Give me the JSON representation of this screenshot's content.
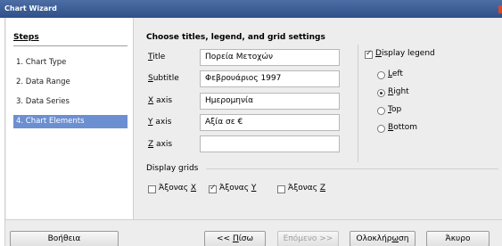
{
  "window": {
    "title": "Chart Wizard"
  },
  "steps": {
    "title": "Steps",
    "items": [
      {
        "label": "1. Chart Type"
      },
      {
        "label": "2. Data Range"
      },
      {
        "label": "3. Data Series"
      },
      {
        "label": "4. Chart Elements",
        "active": true
      }
    ]
  },
  "content": {
    "section_title": "Choose titles, legend, and grid settings",
    "fields": {
      "title": {
        "label_pre": "",
        "label_u": "T",
        "label_post": "itle",
        "value": "Πορεία Μετοχών"
      },
      "subtitle": {
        "label_pre": "",
        "label_u": "S",
        "label_post": "ubtitle",
        "value": "Φεβρουάριος 1997"
      },
      "xaxis": {
        "label_pre": "",
        "label_u": "X",
        "label_post": " axis",
        "value": "Ημερομηνία"
      },
      "yaxis": {
        "label_pre": "",
        "label_u": "Y",
        "label_post": " axis",
        "value": "Αξία σε €"
      },
      "zaxis": {
        "label_pre": "",
        "label_u": "Z",
        "label_post": " axis",
        "value": ""
      }
    },
    "legend": {
      "display_pre": "",
      "display_u": "D",
      "display_post": "isplay legend",
      "checked": true,
      "options": [
        {
          "pre": "",
          "u": "L",
          "post": "eft",
          "selected": false
        },
        {
          "pre": "",
          "u": "R",
          "post": "ight",
          "selected": true
        },
        {
          "pre": "",
          "u": "T",
          "post": "op",
          "selected": false
        },
        {
          "pre": "",
          "u": "B",
          "post": "ottom",
          "selected": false
        }
      ]
    },
    "grids": {
      "title": "Display grids",
      "x": {
        "pre": "Άξονας ",
        "u": "X",
        "checked": false
      },
      "y": {
        "pre": "Άξονας ",
        "u": "Y",
        "checked": true
      },
      "z": {
        "pre": "Άξονας ",
        "u": "Z",
        "checked": false
      }
    }
  },
  "buttons": {
    "help": "Βοήθεια",
    "back_pre": "<< ",
    "back_u": "Π",
    "back_post": "ίσω",
    "next": "Επόμενο >>",
    "finish_pre": "Ολοκλήρ",
    "finish_u": "ω",
    "finish_post": "ση",
    "cancel": "Άκυρο"
  },
  "colors": {
    "titlebar": "#2f5088",
    "selection": "#6c8fd2"
  }
}
